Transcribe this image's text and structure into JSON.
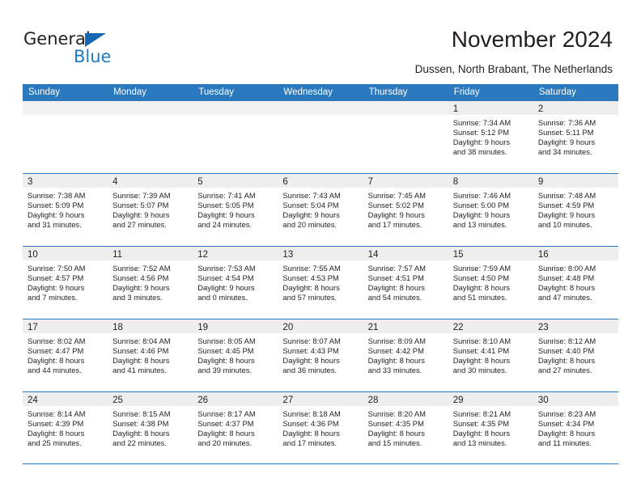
{
  "logo": {
    "word_top": "General",
    "word_bottom": "Blue",
    "accent_color": "#1668b3",
    "text_color": "#231f20",
    "blue_text_color": "#1f7ac4"
  },
  "header": {
    "title": "November 2024",
    "subtitle": "Dussen, North Brabant, The Netherlands"
  },
  "calendar": {
    "header_bg": "#2a78bd",
    "header_text_color": "#ffffff",
    "daynum_band_bg": "#eeeeee",
    "weekday_names": [
      "Sunday",
      "Monday",
      "Tuesday",
      "Wednesday",
      "Thursday",
      "Friday",
      "Saturday"
    ],
    "weeks": [
      [
        {
          "day": "",
          "lines": []
        },
        {
          "day": "",
          "lines": []
        },
        {
          "day": "",
          "lines": []
        },
        {
          "day": "",
          "lines": []
        },
        {
          "day": "",
          "lines": []
        },
        {
          "day": "1",
          "lines": [
            "Sunrise: 7:34 AM",
            "Sunset: 5:12 PM",
            "Daylight: 9 hours",
            "and 38 minutes."
          ]
        },
        {
          "day": "2",
          "lines": [
            "Sunrise: 7:36 AM",
            "Sunset: 5:11 PM",
            "Daylight: 9 hours",
            "and 34 minutes."
          ]
        }
      ],
      [
        {
          "day": "3",
          "lines": [
            "Sunrise: 7:38 AM",
            "Sunset: 5:09 PM",
            "Daylight: 9 hours",
            "and 31 minutes."
          ]
        },
        {
          "day": "4",
          "lines": [
            "Sunrise: 7:39 AM",
            "Sunset: 5:07 PM",
            "Daylight: 9 hours",
            "and 27 minutes."
          ]
        },
        {
          "day": "5",
          "lines": [
            "Sunrise: 7:41 AM",
            "Sunset: 5:05 PM",
            "Daylight: 9 hours",
            "and 24 minutes."
          ]
        },
        {
          "day": "6",
          "lines": [
            "Sunrise: 7:43 AM",
            "Sunset: 5:04 PM",
            "Daylight: 9 hours",
            "and 20 minutes."
          ]
        },
        {
          "day": "7",
          "lines": [
            "Sunrise: 7:45 AM",
            "Sunset: 5:02 PM",
            "Daylight: 9 hours",
            "and 17 minutes."
          ]
        },
        {
          "day": "8",
          "lines": [
            "Sunrise: 7:46 AM",
            "Sunset: 5:00 PM",
            "Daylight: 9 hours",
            "and 13 minutes."
          ]
        },
        {
          "day": "9",
          "lines": [
            "Sunrise: 7:48 AM",
            "Sunset: 4:59 PM",
            "Daylight: 9 hours",
            "and 10 minutes."
          ]
        }
      ],
      [
        {
          "day": "10",
          "lines": [
            "Sunrise: 7:50 AM",
            "Sunset: 4:57 PM",
            "Daylight: 9 hours",
            "and 7 minutes."
          ]
        },
        {
          "day": "11",
          "lines": [
            "Sunrise: 7:52 AM",
            "Sunset: 4:56 PM",
            "Daylight: 9 hours",
            "and 3 minutes."
          ]
        },
        {
          "day": "12",
          "lines": [
            "Sunrise: 7:53 AM",
            "Sunset: 4:54 PM",
            "Daylight: 9 hours",
            "and 0 minutes."
          ]
        },
        {
          "day": "13",
          "lines": [
            "Sunrise: 7:55 AM",
            "Sunset: 4:53 PM",
            "Daylight: 8 hours",
            "and 57 minutes."
          ]
        },
        {
          "day": "14",
          "lines": [
            "Sunrise: 7:57 AM",
            "Sunset: 4:51 PM",
            "Daylight: 8 hours",
            "and 54 minutes."
          ]
        },
        {
          "day": "15",
          "lines": [
            "Sunrise: 7:59 AM",
            "Sunset: 4:50 PM",
            "Daylight: 8 hours",
            "and 51 minutes."
          ]
        },
        {
          "day": "16",
          "lines": [
            "Sunrise: 8:00 AM",
            "Sunset: 4:48 PM",
            "Daylight: 8 hours",
            "and 47 minutes."
          ]
        }
      ],
      [
        {
          "day": "17",
          "lines": [
            "Sunrise: 8:02 AM",
            "Sunset: 4:47 PM",
            "Daylight: 8 hours",
            "and 44 minutes."
          ]
        },
        {
          "day": "18",
          "lines": [
            "Sunrise: 8:04 AM",
            "Sunset: 4:46 PM",
            "Daylight: 8 hours",
            "and 41 minutes."
          ]
        },
        {
          "day": "19",
          "lines": [
            "Sunrise: 8:05 AM",
            "Sunset: 4:45 PM",
            "Daylight: 8 hours",
            "and 39 minutes."
          ]
        },
        {
          "day": "20",
          "lines": [
            "Sunrise: 8:07 AM",
            "Sunset: 4:43 PM",
            "Daylight: 8 hours",
            "and 36 minutes."
          ]
        },
        {
          "day": "21",
          "lines": [
            "Sunrise: 8:09 AM",
            "Sunset: 4:42 PM",
            "Daylight: 8 hours",
            "and 33 minutes."
          ]
        },
        {
          "day": "22",
          "lines": [
            "Sunrise: 8:10 AM",
            "Sunset: 4:41 PM",
            "Daylight: 8 hours",
            "and 30 minutes."
          ]
        },
        {
          "day": "23",
          "lines": [
            "Sunrise: 8:12 AM",
            "Sunset: 4:40 PM",
            "Daylight: 8 hours",
            "and 27 minutes."
          ]
        }
      ],
      [
        {
          "day": "24",
          "lines": [
            "Sunrise: 8:14 AM",
            "Sunset: 4:39 PM",
            "Daylight: 8 hours",
            "and 25 minutes."
          ]
        },
        {
          "day": "25",
          "lines": [
            "Sunrise: 8:15 AM",
            "Sunset: 4:38 PM",
            "Daylight: 8 hours",
            "and 22 minutes."
          ]
        },
        {
          "day": "26",
          "lines": [
            "Sunrise: 8:17 AM",
            "Sunset: 4:37 PM",
            "Daylight: 8 hours",
            "and 20 minutes."
          ]
        },
        {
          "day": "27",
          "lines": [
            "Sunrise: 8:18 AM",
            "Sunset: 4:36 PM",
            "Daylight: 8 hours",
            "and 17 minutes."
          ]
        },
        {
          "day": "28",
          "lines": [
            "Sunrise: 8:20 AM",
            "Sunset: 4:35 PM",
            "Daylight: 8 hours",
            "and 15 minutes."
          ]
        },
        {
          "day": "29",
          "lines": [
            "Sunrise: 8:21 AM",
            "Sunset: 4:35 PM",
            "Daylight: 8 hours",
            "and 13 minutes."
          ]
        },
        {
          "day": "30",
          "lines": [
            "Sunrise: 8:23 AM",
            "Sunset: 4:34 PM",
            "Daylight: 8 hours",
            "and 11 minutes."
          ]
        }
      ]
    ]
  }
}
